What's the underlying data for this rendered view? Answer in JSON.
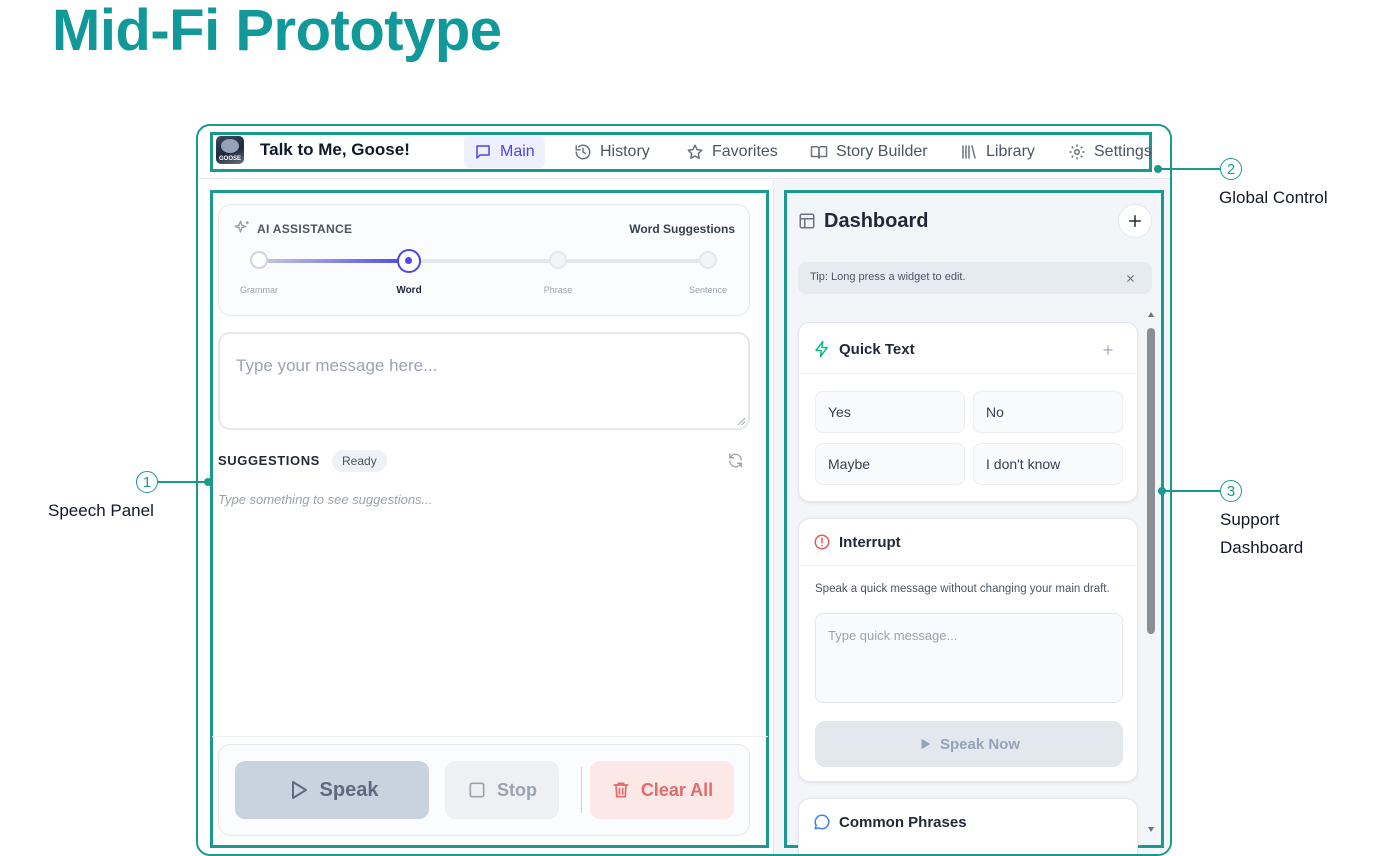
{
  "page_title": "Mid-Fi Prototype",
  "app": {
    "name": "Talk to Me, Goose!",
    "logo_text": "GOOSE"
  },
  "nav": {
    "items": [
      {
        "label": "Main",
        "icon": "message-square-icon",
        "active": true
      },
      {
        "label": "History",
        "icon": "history-icon"
      },
      {
        "label": "Favorites",
        "icon": "star-icon"
      },
      {
        "label": "Story Builder",
        "icon": "book-open-icon"
      },
      {
        "label": "Library",
        "icon": "library-icon"
      },
      {
        "label": "Settings",
        "icon": "gear-icon"
      }
    ]
  },
  "speech_panel": {
    "ai_assistance_label": "AI ASSISTANCE",
    "mode_label": "Word Suggestions",
    "slider": {
      "steps": [
        "Grammar",
        "Word",
        "Phrase",
        "Sentence"
      ],
      "selected_index": 1
    },
    "message_placeholder": "Type your message here...",
    "suggestions_label": "SUGGESTIONS",
    "suggestions_status": "Ready",
    "suggestions_hint": "Type something to see suggestions...",
    "buttons": {
      "speak": "Speak",
      "stop": "Stop",
      "clear_all": "Clear All"
    }
  },
  "dashboard": {
    "title": "Dashboard",
    "tip": "Tip: Long press a widget to edit.",
    "quick_text": {
      "title": "Quick Text",
      "items": [
        "Yes",
        "No",
        "Maybe",
        "I don't know"
      ]
    },
    "interrupt": {
      "title": "Interrupt",
      "description": "Speak a quick message without changing your main draft.",
      "placeholder": "Type quick message...",
      "speak_now": "Speak Now"
    },
    "common_phrases": {
      "title": "Common Phrases"
    }
  },
  "annotations": {
    "speech_panel": {
      "number": "1",
      "label": "Speech Panel"
    },
    "global_control": {
      "number": "2",
      "label": "Global Control"
    },
    "support_dashboard": {
      "number": "3",
      "label_line1": "Support",
      "label_line2": "Dashboard"
    }
  },
  "colors": {
    "teal": "#1a9a8e",
    "title_teal": "#119999",
    "indigo": "#4f46e5",
    "red": "#e05a5a"
  }
}
